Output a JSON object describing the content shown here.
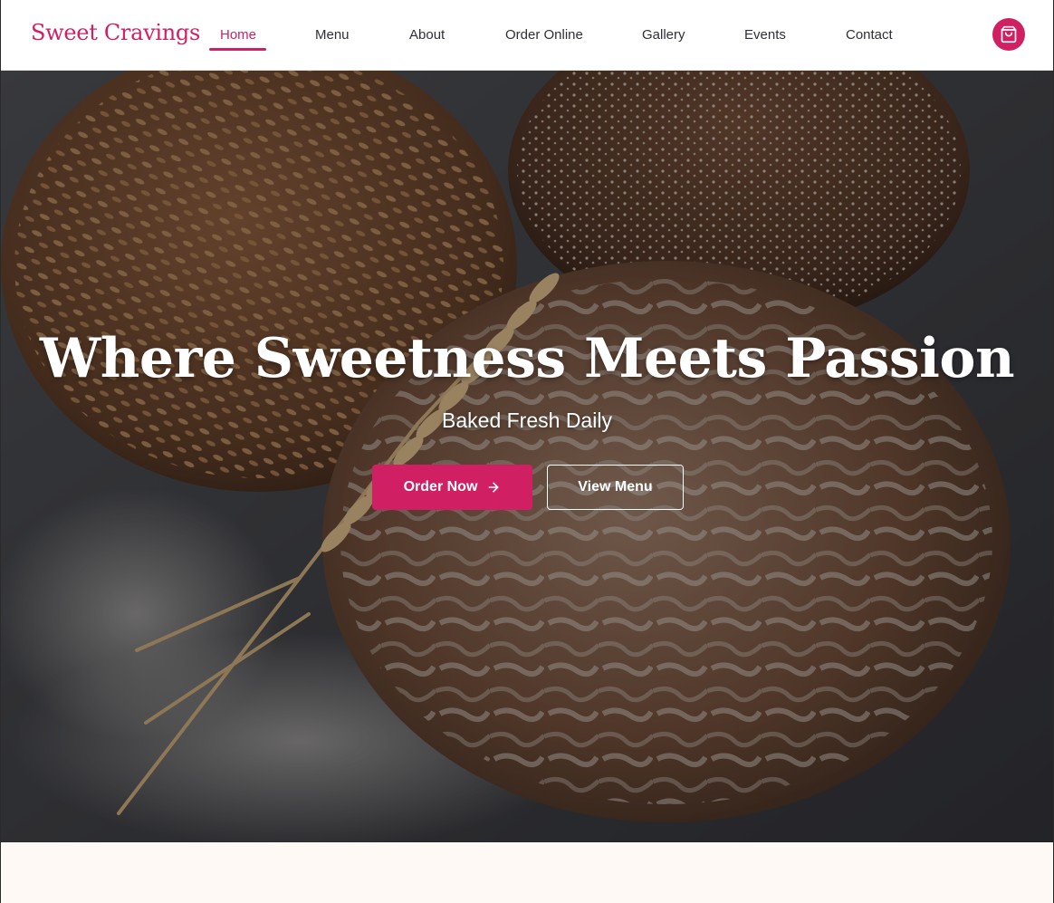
{
  "brand": {
    "name": "Sweet Cravings"
  },
  "nav": {
    "items": [
      {
        "label": "Home",
        "active": true
      },
      {
        "label": "Menu",
        "active": false
      },
      {
        "label": "About",
        "active": false
      },
      {
        "label": "Order Online",
        "active": false
      },
      {
        "label": "Gallery",
        "active": false
      },
      {
        "label": "Events",
        "active": false
      },
      {
        "label": "Contact",
        "active": false
      }
    ],
    "cart_icon": "shopping-bag-icon"
  },
  "hero": {
    "title": "Where Sweetness Meets Passion",
    "subtitle": "Baked Fresh Daily",
    "primary_button": {
      "label": "Order Now",
      "icon": "arrow-right-icon"
    },
    "secondary_button": {
      "label": "View Menu"
    },
    "background_image": "rustic bread loaves with wheat stalks and flour"
  },
  "colors": {
    "accent": "#d11f63",
    "nav_text": "#2f2f38",
    "page_background": "#fff9f5",
    "header_background": "#ffffff"
  }
}
